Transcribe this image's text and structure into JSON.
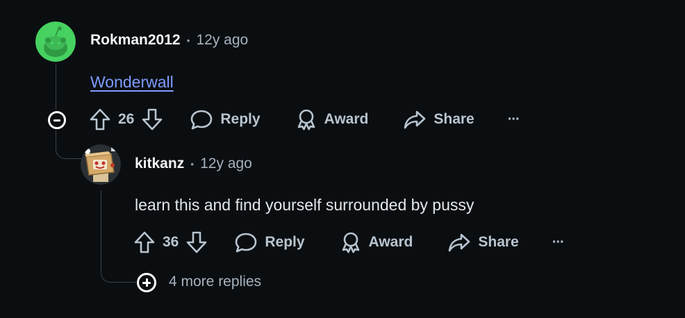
{
  "comments": [
    {
      "username": "Rokman2012",
      "separator": "•",
      "time": "12y ago",
      "body_link": "Wonderwall",
      "score": "26",
      "avatar_icon": "snoo-green-avatar-icon",
      "actions": {
        "reply": "Reply",
        "award": "Award",
        "share": "Share",
        "more": "···"
      }
    },
    {
      "username": "kitkanz",
      "separator": "•",
      "time": "12y ago",
      "body": "learn this and find yourself surrounded by pussy",
      "score": "36",
      "avatar_icon": "box-head-robot-avatar-icon",
      "actions": {
        "reply": "Reply",
        "award": "Award",
        "share": "Share",
        "more": "···"
      }
    }
  ],
  "more_replies": "4 more replies",
  "colors": {
    "background": "#0b0e11",
    "link": "#7e9cff",
    "username": "#f2f4f5",
    "muted": "#a6b3be",
    "avatar_green": "#46d160"
  }
}
